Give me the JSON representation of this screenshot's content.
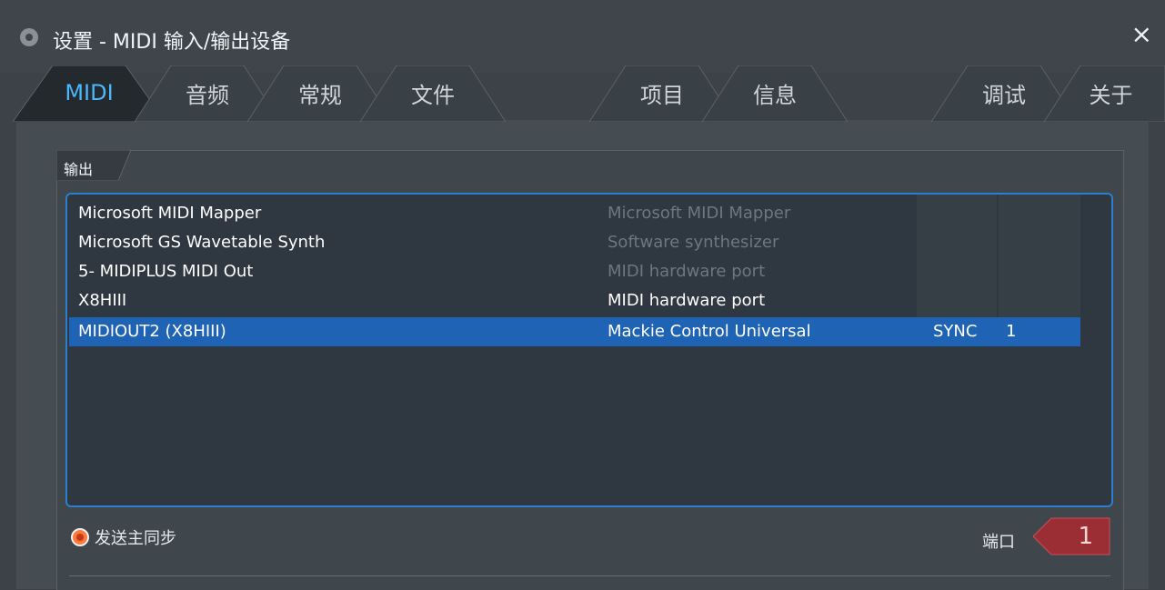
{
  "window": {
    "title": "设置 - MIDI 输入/输出设备",
    "title_icon": "midi-plug-icon",
    "close_glyph": "×"
  },
  "tabs": [
    {
      "label": "MIDI",
      "active": true
    },
    {
      "label": "音频",
      "active": false
    },
    {
      "label": "常规",
      "active": false
    },
    {
      "label": "文件",
      "active": false
    },
    {
      "label": "项目",
      "active": false
    },
    {
      "label": "信息",
      "active": false
    },
    {
      "label": "调试",
      "active": false
    },
    {
      "label": "关于",
      "active": false
    }
  ],
  "output": {
    "group_label": "输出",
    "devices": [
      {
        "name": "Microsoft MIDI Mapper",
        "description": "Microsoft MIDI Mapper",
        "sync": "",
        "port": "",
        "dim_description": true,
        "selected": false
      },
      {
        "name": "Microsoft GS Wavetable Synth",
        "description": "Software synthesizer",
        "sync": "",
        "port": "",
        "dim_description": true,
        "selected": false
      },
      {
        "name": "5- MIDIPLUS MIDI Out",
        "description": "MIDI hardware port",
        "sync": "",
        "port": "",
        "dim_description": true,
        "selected": false
      },
      {
        "name": "X8HIII",
        "description": "MIDI hardware port",
        "sync": "",
        "port": "",
        "dim_description": false,
        "selected": false
      },
      {
        "name": "MIDIOUT2 (X8HIII)",
        "description": "Mackie Control Universal",
        "sync": "SYNC",
        "port": "1",
        "dim_description": false,
        "selected": true
      }
    ],
    "send_master_sync_label": "发送主同步",
    "send_master_sync_on": true,
    "port_label": "端口",
    "port_value": "1"
  },
  "colors": {
    "accent_tab": "#49b8ff",
    "selection": "#1f63b4",
    "list_border": "#2a7fd0",
    "port_box": "#9b2d35"
  }
}
